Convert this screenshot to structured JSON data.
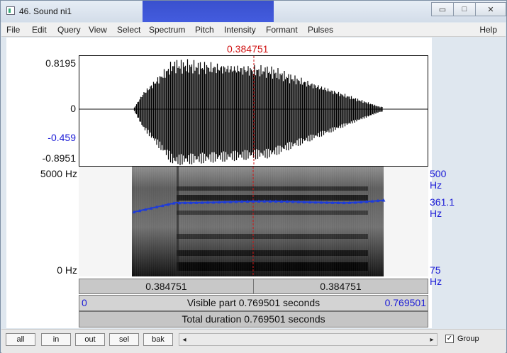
{
  "window": {
    "title": "46. Sound ni1",
    "min_glyph": "▭",
    "max_glyph": "□",
    "close_glyph": "✕"
  },
  "menu": {
    "items": [
      "File",
      "Edit",
      "Query",
      "View",
      "Select",
      "Spectrum",
      "Pitch",
      "Intensity",
      "Formant",
      "Pulses"
    ],
    "help": "Help"
  },
  "editor": {
    "cursor_time": "0.384751",
    "waveform": {
      "max_label": "0.8195",
      "zero_label": "0",
      "sel_label": "-0.459",
      "min_label": "-0.8951"
    },
    "spectrogram": {
      "top_label": "5000 Hz",
      "bottom_label": "0 Hz"
    },
    "pitch": {
      "top_label": "500 Hz",
      "value_label": "361.1 Hz",
      "bottom_label": "75 Hz"
    },
    "time_row": {
      "left": "0.384751",
      "right": "0.384751"
    },
    "visible_row": {
      "start": "0",
      "text": "Visible part 0.769501 seconds",
      "end": "0.769501"
    },
    "total_row": {
      "text": "Total duration 0.769501 seconds"
    }
  },
  "bottom": {
    "buttons": [
      "all",
      "in",
      "out",
      "sel",
      "bak"
    ],
    "scroll_left": "◂",
    "scroll_right": "▸",
    "group_checked": "✓",
    "group_label": "Group"
  }
}
